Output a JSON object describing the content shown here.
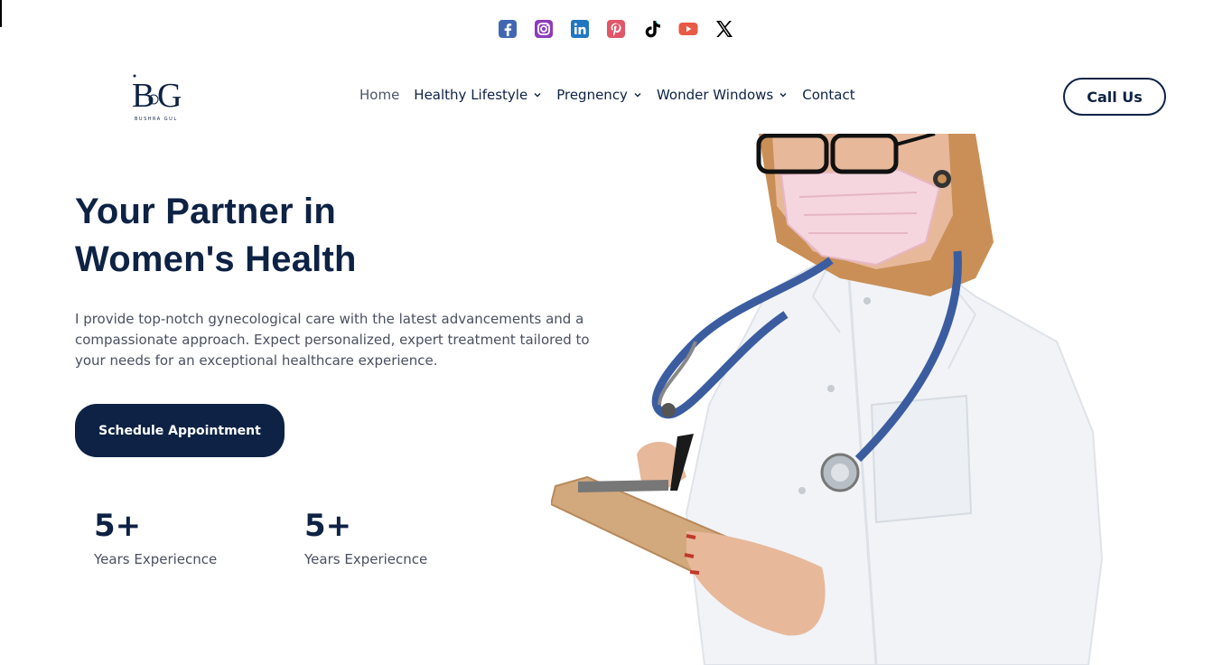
{
  "social": [
    {
      "name": "facebook-icon",
      "color": "#3b5998"
    },
    {
      "name": "instagram-icon",
      "color": "#8a3ab9"
    },
    {
      "name": "linkedin-icon",
      "color": "#1f6eb8"
    },
    {
      "name": "pinterest-icon",
      "color": "#e0566a"
    },
    {
      "name": "tiktok-icon",
      "color": "#000000"
    },
    {
      "name": "youtube-icon",
      "color": "#e85a46"
    },
    {
      "name": "x-icon",
      "color": "#000000"
    }
  ],
  "logo": {
    "mark": "BG",
    "subtitle": "BUSHRA GUL"
  },
  "nav": {
    "items": [
      {
        "label": "Home",
        "has_dropdown": false,
        "active": true
      },
      {
        "label": "Healthy Lifestyle",
        "has_dropdown": true,
        "active": false
      },
      {
        "label": "Pregnency",
        "has_dropdown": true,
        "active": false
      },
      {
        "label": "Wonder Windows",
        "has_dropdown": true,
        "active": false
      },
      {
        "label": "Contact",
        "has_dropdown": false,
        "active": false
      }
    ],
    "call_label": "Call Us"
  },
  "hero": {
    "title_line1": "Your Partner in",
    "title_line2": "Women's Health",
    "description": "I provide top-notch gynecological care with the latest advancements and a compassionate approach. Expect personalized, expert treatment tailored to your needs for an exceptional healthcare experience.",
    "cta_label": "Schedule Appointment"
  },
  "stats": [
    {
      "value": "5+",
      "label": "Years Experiecnce"
    },
    {
      "value": "5+",
      "label": "Years Experiecnce"
    }
  ],
  "colors": {
    "primary": "#0d2244",
    "text": "#4a5060"
  }
}
